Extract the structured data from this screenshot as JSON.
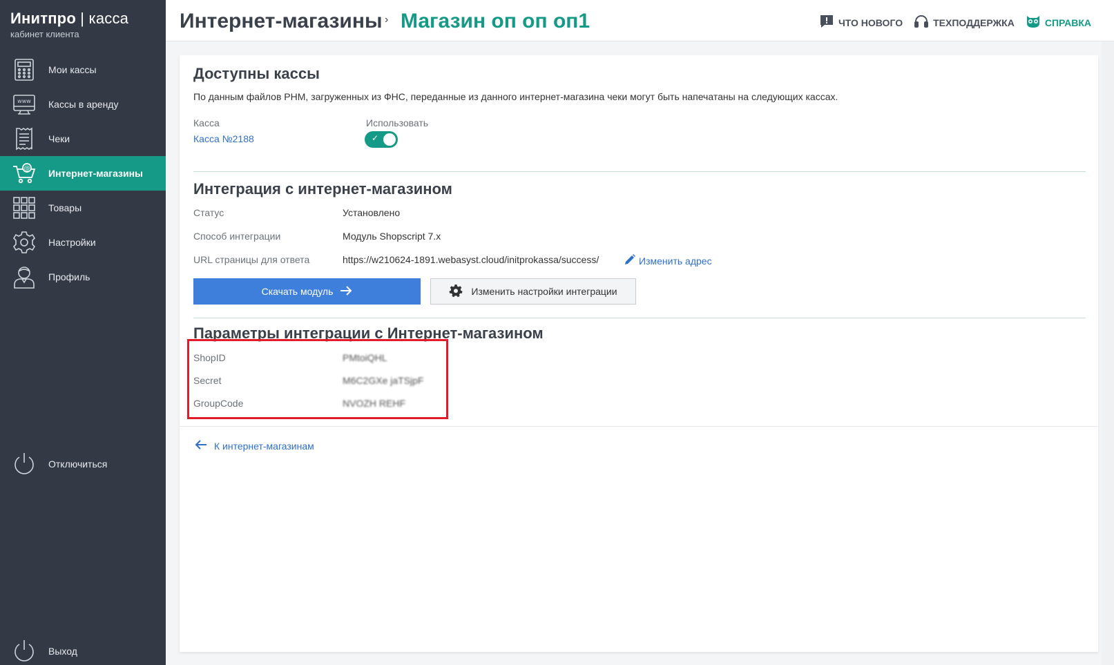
{
  "brand": {
    "name_bold": "Инитпро",
    "sep": "|",
    "name_light": "касса",
    "subtitle": "кабинет клиента"
  },
  "sidebar": {
    "items": [
      {
        "label": "Мои кассы",
        "icon": "cash-register-icon"
      },
      {
        "label": "Кассы в аренду",
        "icon": "www-terminal-icon"
      },
      {
        "label": "Чеки",
        "icon": "receipt-icon"
      },
      {
        "label": "Интернет-магазины",
        "icon": "shopping-cart-icon",
        "active": true
      },
      {
        "label": "Товары",
        "icon": "grid-icon"
      },
      {
        "label": "Настройки",
        "icon": "gear-icon"
      },
      {
        "label": "Профиль",
        "icon": "user-icon"
      }
    ],
    "disconnect_label": "Отключиться",
    "logout_label": "Выход"
  },
  "header": {
    "crumb_root": "Интернет-магазины",
    "crumb_sep": "›",
    "crumb_current": "Магазин оп оп оп1",
    "links": {
      "whats_new": "ЧТО НОВОГО",
      "support": "ТЕХПОДДЕРЖКА",
      "help": "СПРАВКА"
    }
  },
  "available": {
    "title": "Доступны кассы",
    "description": "По данным файлов РНМ, загруженных из ФНС, переданные из данного интернет-магазина чеки могут быть напечатаны на следующих кассах.",
    "col_kassa": "Касса",
    "col_use": "Использовать",
    "kassa_link": "Касса №2188",
    "use_enabled": true
  },
  "integration": {
    "title": "Интеграция с интернет-магазином",
    "status_label": "Статус",
    "status_value": "Установлено",
    "method_label": "Способ интеграции",
    "method_value": "Модуль Shopscript 7.x",
    "url_label": "URL страницы для ответа",
    "url_value": "https://w210624-1891.webasyst.cloud/initprokassa/success/",
    "change_url": "Изменить адрес",
    "download_btn": "Скачать модуль",
    "settings_btn": "Изменить настройки интеграции"
  },
  "params": {
    "title": "Параметры интеграции с Интернет-магазином",
    "shopid_label": "ShopID",
    "shopid_value": "PMtoiQHL",
    "secret_label": "Secret",
    "secret_value": "M6C2GXe jaTSjpF",
    "groupcode_label": "GroupCode",
    "groupcode_value": "NVOZH REHF"
  },
  "back_link": "К интернет-магазинам",
  "colors": {
    "sidebar_bg": "#333a46",
    "accent": "#149a86",
    "primary_btn": "#3f7fdc",
    "link": "#2f6fca",
    "highlight_box": "#e21b2a"
  }
}
